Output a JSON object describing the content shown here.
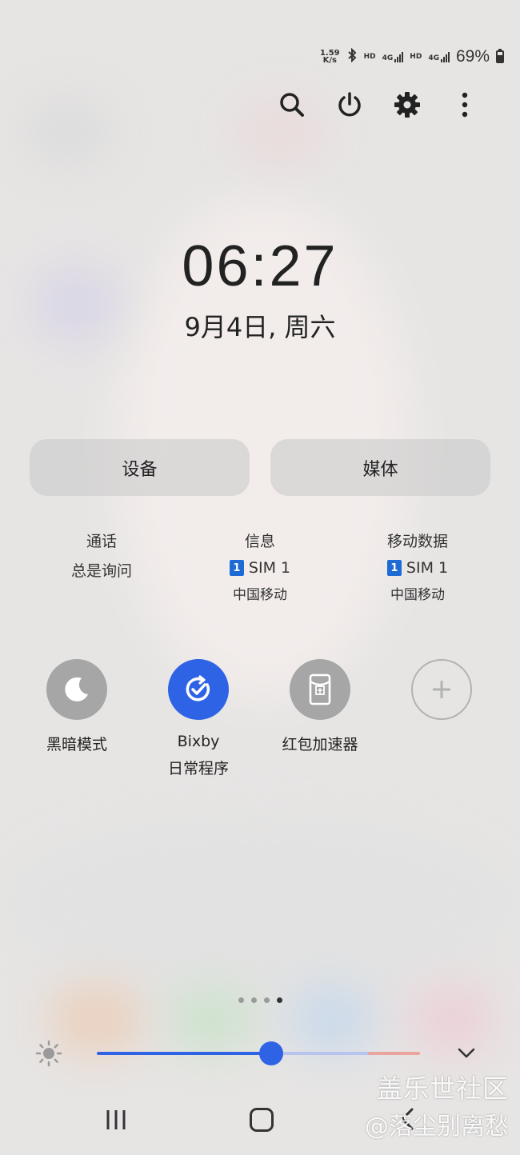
{
  "status_bar": {
    "net_speed_value": "1.59",
    "net_speed_unit": "K/s",
    "hd_1": "HD",
    "net_1": "4G",
    "hd_2": "HD",
    "net_2": "4G",
    "battery": "69%",
    "icons": [
      "bluetooth-icon",
      "signal-icon",
      "battery-icon"
    ]
  },
  "actions": {
    "icons": [
      "search-icon",
      "power-icon",
      "gear-icon",
      "more-vertical-icon"
    ]
  },
  "clock": {
    "time": "06:27",
    "date": "9月4日, 周六"
  },
  "output_buttons": {
    "devices": "设备",
    "media": "媒体"
  },
  "sim_settings": [
    {
      "title": "通话",
      "value": "总是询问"
    },
    {
      "title": "信息",
      "sim_badge": "1",
      "value": "SIM 1",
      "carrier": "中国移动"
    },
    {
      "title": "移动数据",
      "sim_badge": "1",
      "value": "SIM 1",
      "carrier": "中国移动"
    }
  ],
  "quick_tiles": [
    {
      "label": "黑暗模式",
      "icon": "moon-icon",
      "active": false
    },
    {
      "label": "Bixby",
      "label2": "日常程序",
      "icon": "bixby-routine-icon",
      "active": true
    },
    {
      "label": "红包加速器",
      "icon": "red-envelope-icon",
      "active": false
    },
    {
      "label": "",
      "icon": "add-icon",
      "active": false
    }
  ],
  "page_indicator": {
    "count": 4,
    "current": 4
  },
  "brightness": {
    "level": 0.54
  },
  "colors": {
    "accent": "#2f63e6",
    "sim_badge": "#1f6bd6",
    "tile_inactive": "#a6a6a6"
  },
  "nav_bar": {
    "icons": [
      "recent-apps-icon",
      "home-icon",
      "back-icon"
    ]
  },
  "watermark": {
    "line1": "盖乐世社区",
    "line2": "@落尘别离愁"
  }
}
